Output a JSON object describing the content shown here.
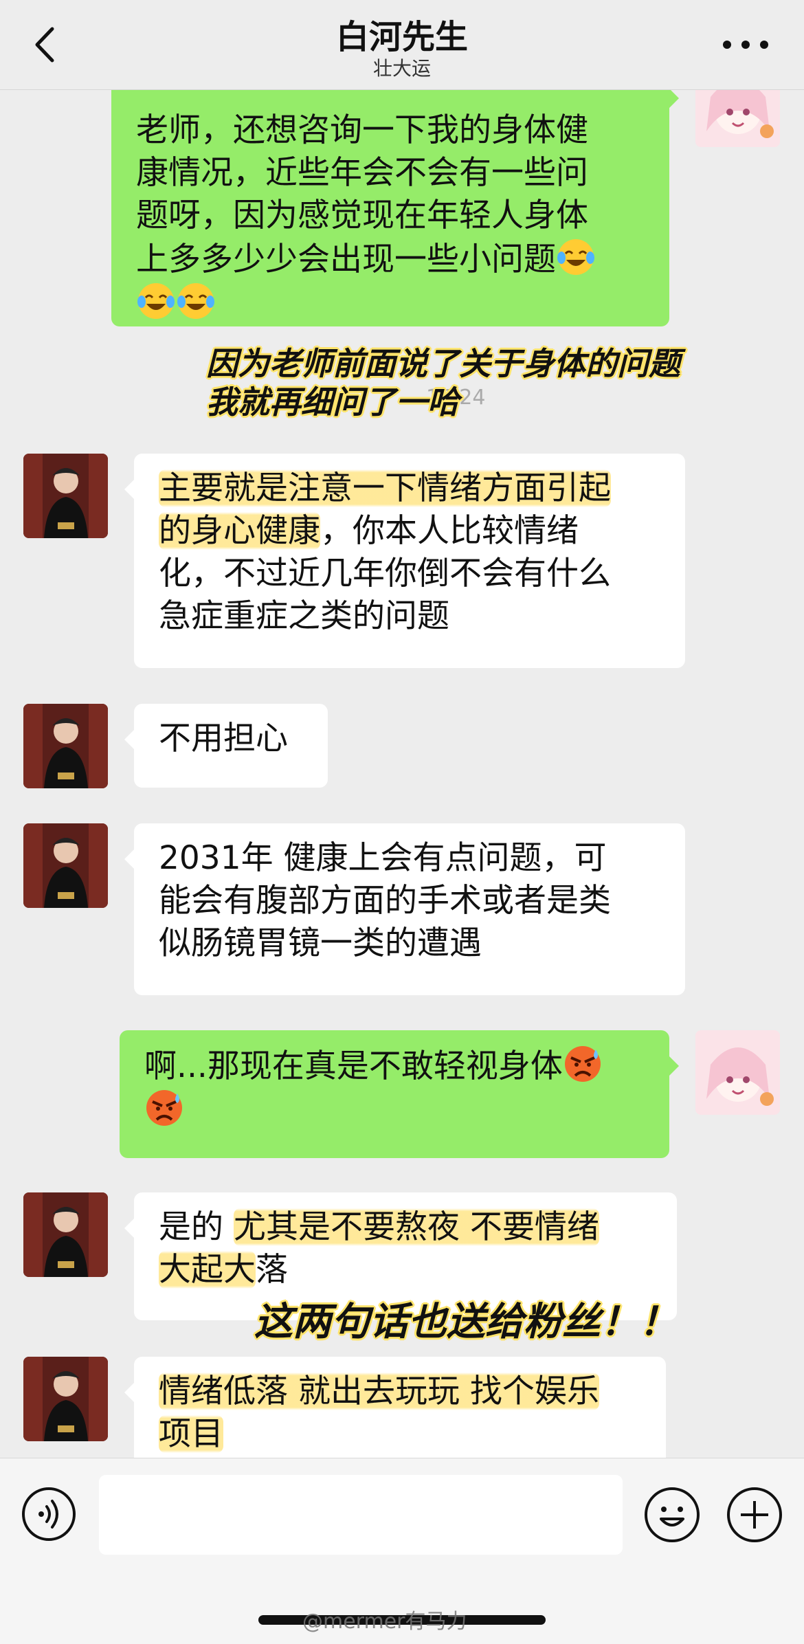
{
  "header": {
    "title": "白河先生",
    "subtitle": "壮大运"
  },
  "messages": [
    {
      "side": "out",
      "lines": [
        "老师，还想咨询一下我的身体健",
        "康情况，近些年会不会有一些问",
        "题呀，因为感觉现在年轻人身体",
        "上多多少少会出现一些小问题"
      ],
      "trailing_emoji": "laughing-tears-emoji"
    },
    {
      "side": "in",
      "highlight": [
        "主要就是注意一下情绪方面引起",
        "的身心健康"
      ],
      "text_after": "，你本人比较情绪",
      "lines": [
        "化，不过近几年你倒不会有什么",
        "急症重症之类的问题"
      ]
    },
    {
      "side": "in",
      "text": "不用担心"
    },
    {
      "side": "in",
      "lines": [
        "2031年 健康上会有点问题，可",
        "能会有腹部方面的手术或者是类",
        "似肠镜胃镜一类的遭遇"
      ]
    },
    {
      "side": "out",
      "text": "啊...那现在真是不敢轻视身体",
      "trailing_emoji": "angry-sweat-emoji"
    },
    {
      "side": "in",
      "text_before": "是的 ",
      "highlight_1": "尤其是不要熬夜 不要情绪",
      "highlight_2": "大起大",
      "text_after": "落"
    },
    {
      "side": "in",
      "highlight_1": "情绪低落 就出去玩玩 找个娱乐",
      "highlight_2": "项目"
    }
  ],
  "timestamp": "17:24",
  "annotations": {
    "note_1_line_1": "因为老师前面说了关于身体的问题",
    "note_1_line_2": "我就再细问了一哈",
    "note_2": "这两句话也送给粉丝！！"
  },
  "watermark": "@mermer有马力",
  "colors": {
    "background": "#ededed",
    "outgoing_bubble": "#95ec69",
    "incoming_bubble": "#ffffff",
    "highlight": "#ffe278",
    "note_outline": "#ffe46b"
  }
}
